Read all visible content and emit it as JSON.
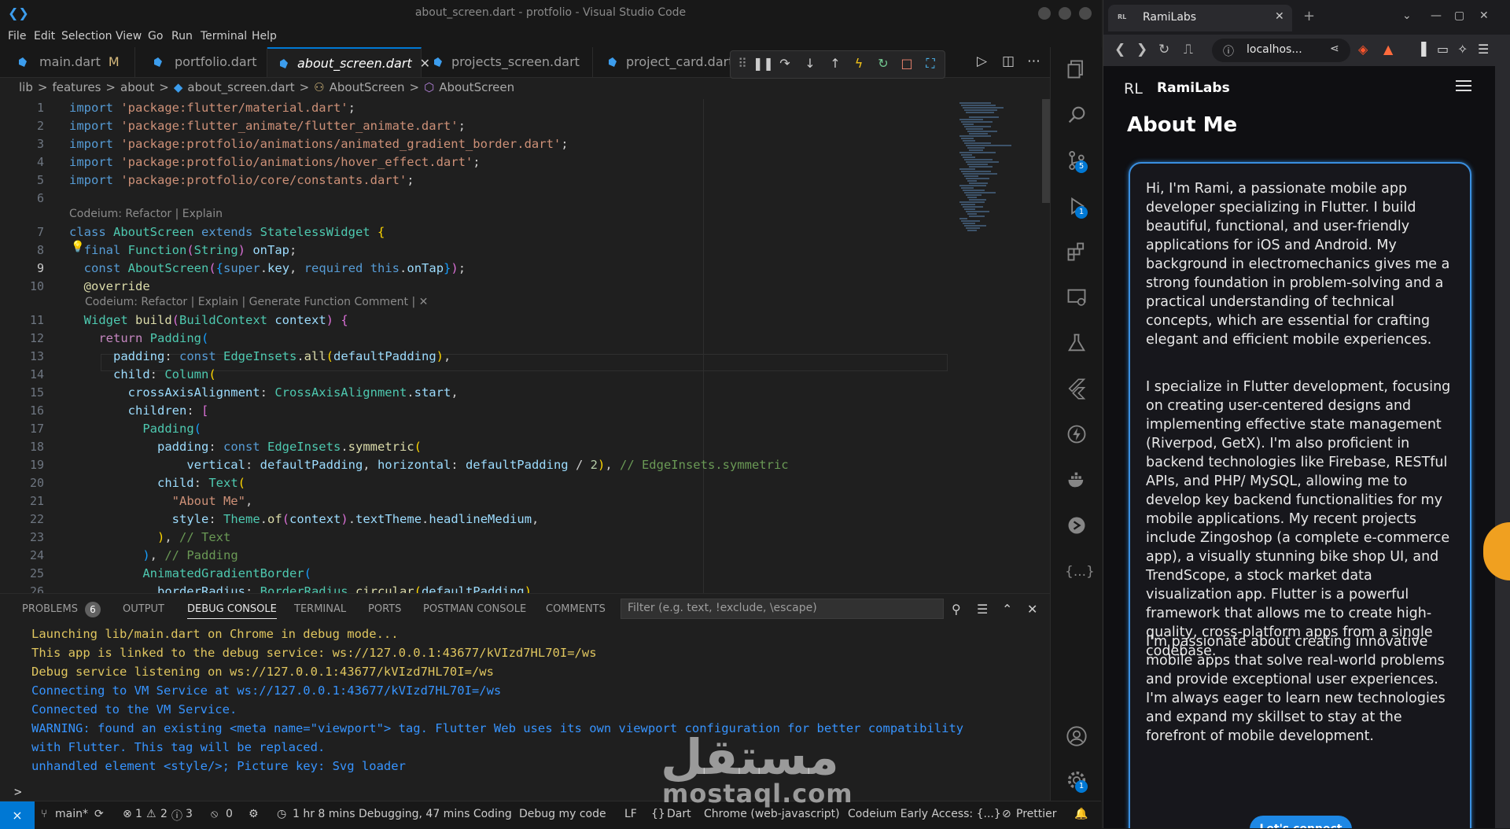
{
  "vscode": {
    "window_title": "about_screen.dart - protfolio - Visual Studio Code",
    "menu": [
      "File",
      "Edit",
      "Selection",
      "View",
      "Go",
      "Run",
      "Terminal",
      "Help"
    ],
    "tabs": [
      {
        "label": "main.dart",
        "modified": "M"
      },
      {
        "label": "portfolio.dart"
      },
      {
        "label": "about_screen.dart",
        "close": "✕"
      },
      {
        "label": "projects_screen.dart"
      },
      {
        "label": "project_card.dart"
      }
    ],
    "breadcrumb": [
      "lib",
      ">",
      "features",
      ">",
      "about",
      ">",
      "about_screen.dart",
      ">",
      "AboutScreen",
      ">",
      "AboutScreen"
    ],
    "codelens1": "Codeium: Refactor | Explain",
    "codelens2": "Codeium: Refactor | Explain | Generate Function Comment | ✕",
    "line_numbers": [
      "1",
      "2",
      "3",
      "4",
      "5",
      "6",
      "7",
      "8",
      "9",
      "10",
      "11",
      "12",
      "13",
      "14",
      "15",
      "16",
      "17",
      "18",
      "19",
      "20",
      "21",
      "22",
      "23",
      "24",
      "25",
      "26"
    ],
    "panel": {
      "tabs": [
        "PROBLEMS",
        "OUTPUT",
        "DEBUG CONSOLE",
        "TERMINAL",
        "PORTS",
        "POSTMAN CONSOLE",
        "COMMENTS"
      ],
      "problems_count": "6",
      "filter_placeholder": "Filter (e.g. text, !exclude, \\escape)",
      "console_lines": [
        "Launching lib/main.dart on Chrome in debug mode...",
        "This app is linked to the debug service: ws://127.0.0.1:43677/kVIzd7HL70I=/ws",
        "Debug service listening on ws://127.0.0.1:43677/kVIzd7HL70I=/ws",
        "Connecting to VM Service at ws://127.0.0.1:43677/kVIzd7HL70I=/ws",
        "Connected to the VM Service.",
        "WARNING: found an existing <meta name=\"viewport\"> tag. Flutter Web uses its own viewport configuration for better compatibility",
        "with Flutter. This tag will be replaced.",
        "unhandled element <style/>; Picture key: Svg loader"
      ],
      "prompt": ">"
    },
    "activity_badges": {
      "source_control": "5",
      "run_debug": "1",
      "settings": "1"
    },
    "status": {
      "branch": "main*",
      "errors": "1",
      "warnings": "2",
      "info": "3",
      "ports": "0",
      "time": "1 hr 8 mins Debugging, 47 mins Coding",
      "debug_label": "Debug my code",
      "eol": "LF",
      "language": "Dart",
      "device": "Chrome (web-javascript)",
      "codeium": "Codeium Early Access: {...}",
      "prettier": "Prettier"
    }
  },
  "browser": {
    "tab_title": "RamiLabs",
    "favicon_text": "RL",
    "url": "localhos...",
    "site": {
      "logo_text": "RL",
      "brand": "RamiLabs",
      "heading": "About Me",
      "paragraphs": [
        "Hi, I'm Rami, a passionate mobile app developer specializing in Flutter. I build beautiful, functional, and user-friendly applications for iOS and Android. My background in electromechanics gives me a strong foundation in problem-solving and a practical understanding of technical concepts, which are essential for crafting elegant and efficient mobile experiences.",
        "I specialize in Flutter development, focusing on creating user-centered designs and implementing effective state management (Riverpod, GetX). I'm also proficient in backend technologies like Firebase, RESTful APIs, and PHP/ MySQL, allowing me to develop key backend functionalities for my mobile applications. My recent projects include Zingoshop (a complete e-commerce app), a visually stunning bike shop UI, and TrendScope, a stock market data visualization app. Flutter is a powerful framework that allows me to create high-quality, cross-platform apps from a single codebase.",
        "I'm passionate about creating innovative mobile apps that solve real-world problems and provide exceptional user experiences. I'm always eager to learn new technologies and expand my skillset to stay at the forefront of mobile development."
      ],
      "cta": "Let's connect"
    }
  },
  "watermark": {
    "arabic": "مستقل",
    "latin": "mostaql.com"
  },
  "colors": {
    "accent": "#0078d4",
    "card_border": "#3a8fe0",
    "console_yellow": "#e0c65f",
    "console_blue": "#3794ff"
  }
}
